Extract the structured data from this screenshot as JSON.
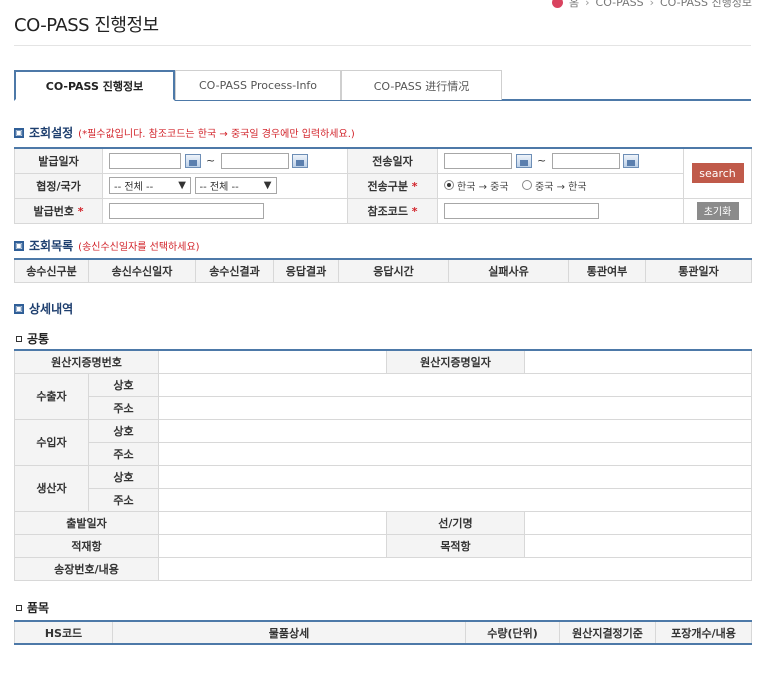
{
  "breadcrumb": {
    "home": "홈",
    "items": [
      "CO-PASS",
      "CO-PASS 진행정보"
    ]
  },
  "page_title": "CO-PASS 진행정보",
  "tabs": [
    "CO-PASS 진행정보",
    "CO-PASS Process-Info",
    "CO-PASS 进行情况"
  ],
  "search": {
    "title": "조회설정",
    "note": "(*필수값입니다. 참조코드는 한국 → 중국일 경우에만 입력하세요.)",
    "issue_date_label": "발급일자",
    "send_date_label": "전송일자",
    "agreement_label": "협정/국가",
    "agreement_select": "-- 전체 --",
    "country_select": "-- 전체 --",
    "send_type_label": "전송구분",
    "radio_kr_cn": "한국 → 중국",
    "radio_cn_kr": "중국 → 한국",
    "issue_no_label": "발급번호",
    "ref_code_label": "참조코드",
    "required_mark": "*",
    "tilde": "~",
    "search_button": "search",
    "reset_button": "초기화"
  },
  "list": {
    "title": "조회목록",
    "note": "(송신수신일자를 선택하세요)",
    "columns": [
      "송수신구분",
      "송신수신일자",
      "송수신결과",
      "응답결과",
      "응답시간",
      "실패사유",
      "통관여부",
      "통관일자"
    ]
  },
  "detail": {
    "title": "상세내역",
    "common_title": "공통",
    "cert_no": "원산지증명번호",
    "cert_date": "원산지증명일자",
    "exporter": "수출자",
    "importer": "수입자",
    "producer": "생산자",
    "name": "상호",
    "address": "주소",
    "depart_date": "출발일자",
    "vessel": "선/기명",
    "loading_port": "적재항",
    "destination": "목적항",
    "invoice": "송장번호/내용"
  },
  "items": {
    "title": "품목",
    "columns": [
      "HS코드",
      "물품상세",
      "수량(단위)",
      "원산지결정기준",
      "포장개수/내용"
    ]
  },
  "colors": {
    "accent": "#4d79a8",
    "required": "#d2232a",
    "search_button": "#c05a4a",
    "reset_button": "#8b8b8b"
  }
}
